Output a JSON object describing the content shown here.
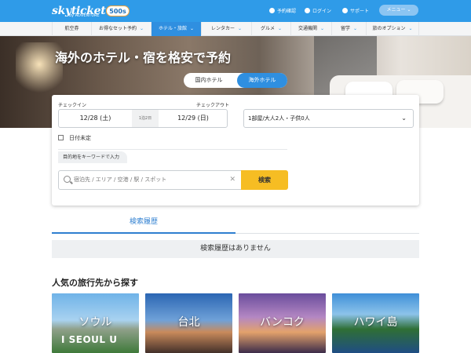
{
  "header": {
    "logo": "skyticket",
    "logo_sub": "by ADVENTURE",
    "badge": "500s",
    "links": [
      "予約確認",
      "ログイン",
      "サポート"
    ],
    "menu_label": "メニュー"
  },
  "nav": [
    {
      "label": "航空券",
      "active": false
    },
    {
      "label": "お得なセット予約",
      "active": false
    },
    {
      "label": "ホテル・旅館",
      "active": true
    },
    {
      "label": "レンタカー",
      "active": false
    },
    {
      "label": "グルメ",
      "active": false
    },
    {
      "label": "交通機関",
      "active": false
    },
    {
      "label": "留学",
      "active": false
    },
    {
      "label": "旅のオプション",
      "active": false
    }
  ],
  "hero": {
    "title": "海外のホテル・宿を格安で予約",
    "tab_domestic": "国内ホテル",
    "tab_overseas": "海外ホテル"
  },
  "search": {
    "checkin_label": "チェックイン",
    "checkout_label": "チェックアウト",
    "checkin": "12/28 (土)",
    "nights": "1泊2日",
    "checkout": "12/29 (日)",
    "guests": "1部屋/大人2人・子供0人",
    "undecided_label": "日付未定",
    "keyword_tab": "目的地をキーワードで入力",
    "placeholder": "宿泊先 / エリア / 空港 / 駅 / スポット",
    "button": "検索"
  },
  "history": {
    "tab": "検索履歴",
    "empty": "検索履歴はありません"
  },
  "popular": {
    "title": "人気の旅行先から探す",
    "destinations": [
      "ソウル",
      "台北",
      "バンコク",
      "ハワイ島"
    ],
    "seoul_sign": "I SEOUL U"
  }
}
